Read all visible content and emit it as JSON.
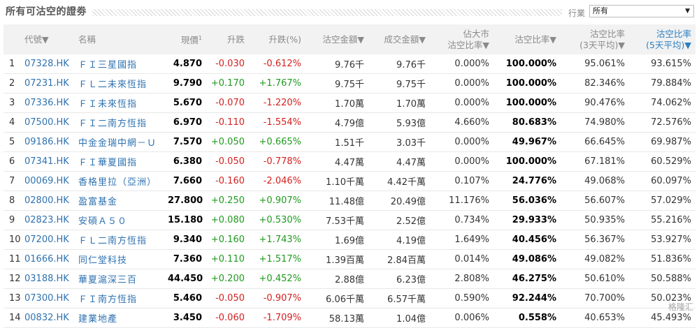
{
  "header": {
    "title": "所有可沽空的證劵",
    "industry_label": "行業",
    "industry_selected": "所有",
    "dropdown_arrow": "▼"
  },
  "columns": {
    "index": "",
    "code": "代號▼",
    "name": "名稱",
    "price": "現價",
    "price_sup": "1",
    "change": "升跌",
    "change_pct": "升跌(%)",
    "short_amount": "沽空金額▼",
    "turnover": "成交金額▼",
    "est_ratio_l1": "佔大市",
    "est_ratio_l2": "沽空比率▼",
    "short_ratio": "沽空比率▼",
    "ratio3_l1": "沽空比率",
    "ratio3_l2": "(3天平均)▼",
    "ratio5_l1": "沽空比率",
    "ratio5_l2": "(5天平均)▼"
  },
  "rows": [
    {
      "idx": "1",
      "code": "07328.HK",
      "name": "ＦＩ三星國指",
      "price": "4.870",
      "change": "-0.030",
      "change_pct": "-0.612%",
      "short_amount": "9.76千",
      "turnover": "9.76千",
      "market_ratio": "0.000%",
      "short_ratio": "100.000%",
      "avg3": "95.061%",
      "avg5": "93.615%",
      "dir": "neg"
    },
    {
      "idx": "2",
      "code": "07231.HK",
      "name": "ＦＬ二未來恆指",
      "price": "9.790",
      "change": "+0.170",
      "change_pct": "+1.767%",
      "short_amount": "9.75千",
      "turnover": "9.75千",
      "market_ratio": "0.000%",
      "short_ratio": "100.000%",
      "avg3": "82.346%",
      "avg5": "79.884%",
      "dir": "pos"
    },
    {
      "idx": "3",
      "code": "07336.HK",
      "name": "ＦＩ未來恆指",
      "price": "5.670",
      "change": "-0.070",
      "change_pct": "-1.220%",
      "short_amount": "1.70萬",
      "turnover": "1.70萬",
      "market_ratio": "0.000%",
      "short_ratio": "100.000%",
      "avg3": "90.476%",
      "avg5": "74.062%",
      "dir": "neg"
    },
    {
      "idx": "4",
      "code": "07500.HK",
      "name": "ＦＩ二南方恆指",
      "price": "6.970",
      "change": "-0.110",
      "change_pct": "-1.554%",
      "short_amount": "4.79億",
      "turnover": "5.93億",
      "market_ratio": "4.660%",
      "short_ratio": "80.683%",
      "avg3": "74.980%",
      "avg5": "72.576%",
      "dir": "neg"
    },
    {
      "idx": "5",
      "code": "09186.HK",
      "name": "中金金瑞中網－Ｕ",
      "price": "7.570",
      "change": "+0.050",
      "change_pct": "+0.665%",
      "short_amount": "1.51千",
      "turnover": "3.03千",
      "market_ratio": "0.000%",
      "short_ratio": "49.967%",
      "avg3": "66.645%",
      "avg5": "69.987%",
      "dir": "pos"
    },
    {
      "idx": "6",
      "code": "07341.HK",
      "name": "ＦＩ華夏國指",
      "price": "6.380",
      "change": "-0.050",
      "change_pct": "-0.778%",
      "short_amount": "4.47萬",
      "turnover": "4.47萬",
      "market_ratio": "0.000%",
      "short_ratio": "100.000%",
      "avg3": "67.181%",
      "avg5": "60.529%",
      "dir": "neg"
    },
    {
      "idx": "7",
      "code": "00069.HK",
      "name": "香格里拉（亞洲）",
      "price": "7.660",
      "change": "-0.160",
      "change_pct": "-2.046%",
      "short_amount": "1.10千萬",
      "turnover": "4.42千萬",
      "market_ratio": "0.107%",
      "short_ratio": "24.776%",
      "avg3": "49.068%",
      "avg5": "60.097%",
      "dir": "neg"
    },
    {
      "idx": "8",
      "code": "02800.HK",
      "name": "盈富基金",
      "price": "27.800",
      "change": "+0.250",
      "change_pct": "+0.907%",
      "short_amount": "11.48億",
      "turnover": "20.49億",
      "market_ratio": "11.176%",
      "short_ratio": "56.036%",
      "avg3": "56.607%",
      "avg5": "57.029%",
      "dir": "pos"
    },
    {
      "idx": "9",
      "code": "02823.HK",
      "name": "安碩Ａ５０",
      "price": "15.180",
      "change": "+0.080",
      "change_pct": "+0.530%",
      "short_amount": "7.53千萬",
      "turnover": "2.52億",
      "market_ratio": "0.734%",
      "short_ratio": "29.933%",
      "avg3": "50.935%",
      "avg5": "55.216%",
      "dir": "pos"
    },
    {
      "idx": "10",
      "code": "07200.HK",
      "name": "ＦＬ二南方恆指",
      "price": "9.340",
      "change": "+0.160",
      "change_pct": "+1.743%",
      "short_amount": "1.69億",
      "turnover": "4.19億",
      "market_ratio": "1.649%",
      "short_ratio": "40.456%",
      "avg3": "56.367%",
      "avg5": "53.927%",
      "dir": "pos"
    },
    {
      "idx": "11",
      "code": "01666.HK",
      "name": "同仁堂科技",
      "price": "7.360",
      "change": "+0.110",
      "change_pct": "+1.517%",
      "short_amount": "1.39百萬",
      "turnover": "2.84百萬",
      "market_ratio": "0.014%",
      "short_ratio": "49.086%",
      "avg3": "49.082%",
      "avg5": "51.836%",
      "dir": "pos"
    },
    {
      "idx": "12",
      "code": "03188.HK",
      "name": "華夏滬深三百",
      "price": "44.450",
      "change": "+0.200",
      "change_pct": "+0.452%",
      "short_amount": "2.88億",
      "turnover": "6.23億",
      "market_ratio": "2.808%",
      "short_ratio": "46.275%",
      "avg3": "50.610%",
      "avg5": "50.588%",
      "dir": "pos"
    },
    {
      "idx": "13",
      "code": "07300.HK",
      "name": "ＦＩ南方恆指",
      "price": "5.460",
      "change": "-0.050",
      "change_pct": "-0.907%",
      "short_amount": "6.06千萬",
      "turnover": "6.57千萬",
      "market_ratio": "0.590%",
      "short_ratio": "92.244%",
      "avg3": "70.700%",
      "avg5": "50.023%",
      "dir": "neg"
    },
    {
      "idx": "14",
      "code": "00832.HK",
      "name": "建業地產",
      "price": "3.450",
      "change": "-0.060",
      "change_pct": "-1.709%",
      "short_amount": "58.13萬",
      "turnover": "1.04億",
      "market_ratio": "0.006%",
      "short_ratio": "0.558%",
      "avg3": "40.653%",
      "avg5": "45.493%",
      "dir": "neg"
    }
  ],
  "watermark": "格隆汇",
  "colors": {
    "negative": "#d51f1f",
    "positive": "#1f9a1f",
    "link": "#2f72b0",
    "header_bg": "#f2f2f2"
  }
}
